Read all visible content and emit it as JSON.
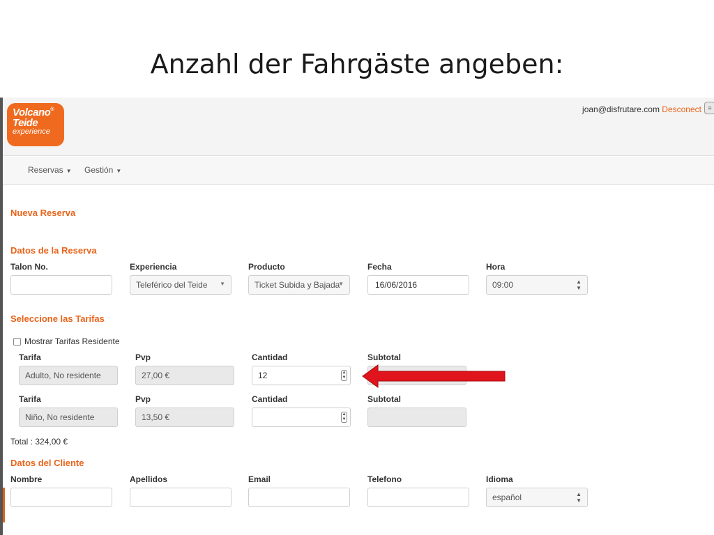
{
  "slide": {
    "title": "Anzahl der Fahrgäste angeben:"
  },
  "logo": {
    "line1": "Volcano",
    "line2": "Teide",
    "line3": "experience",
    "reg": "®"
  },
  "header": {
    "user_email": "joan@disfrutare.com",
    "logout_label": "Desconect"
  },
  "nav": {
    "reservas": "Reservas",
    "gestion": "Gestión"
  },
  "page": {
    "title": "Nueva Reserva"
  },
  "reserva": {
    "section_title": "Datos de la Reserva",
    "talon_label": "Talon No.",
    "talon_value": "",
    "experiencia_label": "Experiencia",
    "experiencia_value": "Teleférico del Teide",
    "producto_label": "Producto",
    "producto_value": "Ticket Subida y Bajada",
    "fecha_label": "Fecha",
    "fecha_value": "16/06/2016",
    "hora_label": "Hora",
    "hora_value": "09:00"
  },
  "tarifas": {
    "section_title": "Seleccione las Tarifas",
    "residente_label": "Mostrar Tarifas Residente",
    "rows": [
      {
        "tarifa_label": "Tarifa",
        "tarifa": "Adulto, No residente",
        "pvp_label": "Pvp",
        "pvp": "27,00 €",
        "cantidad_label": "Cantidad",
        "cantidad": "12",
        "subtotal_label": "Subtotal",
        "subtotal": ""
      },
      {
        "tarifa_label": "Tarifa",
        "tarifa": "Niño, No residente",
        "pvp_label": "Pvp",
        "pvp": "13,50 €",
        "cantidad_label": "Cantidad",
        "cantidad": "",
        "subtotal_label": "Subtotal",
        "subtotal": ""
      }
    ],
    "total": "Total : 324,00 €"
  },
  "cliente": {
    "section_title": "Datos del Cliente",
    "nombre_label": "Nombre",
    "apellidos_label": "Apellidos",
    "email_label": "Email",
    "telefono_label": "Telefono",
    "idioma_label": "Idioma",
    "idioma_value": "español"
  },
  "colors": {
    "accent": "#e8641a",
    "arrow": "#e0141c"
  }
}
